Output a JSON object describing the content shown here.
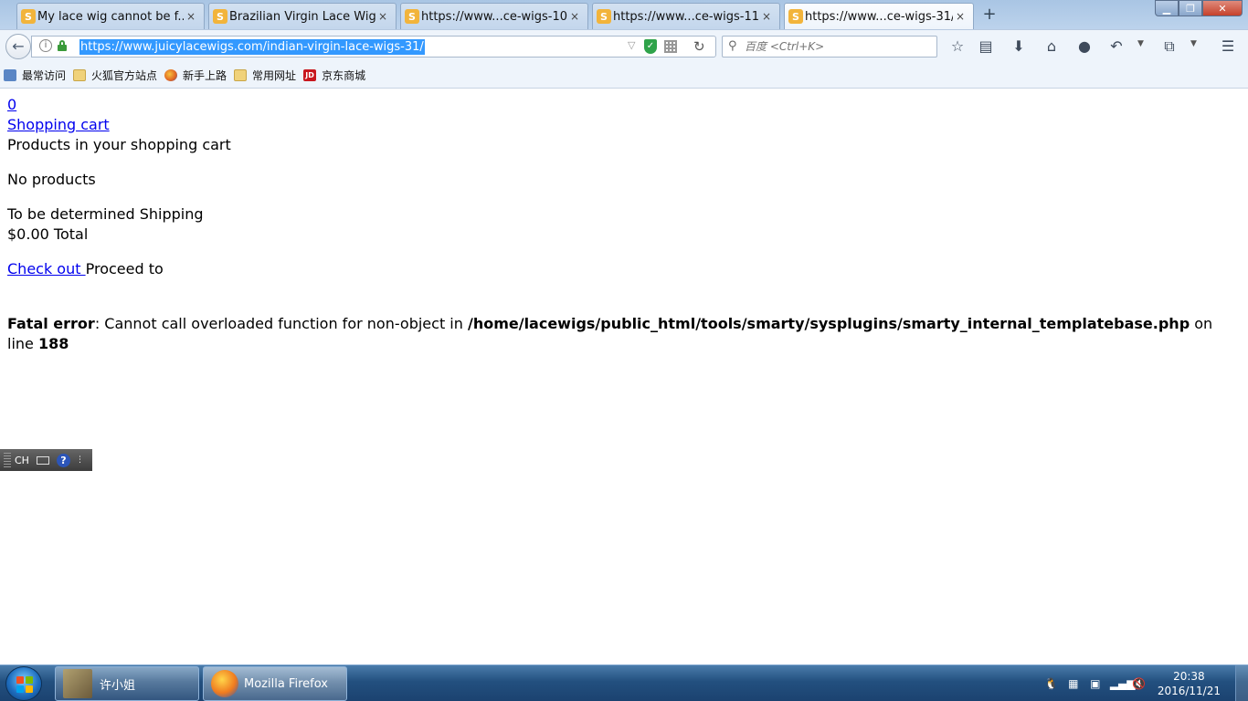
{
  "tabs": [
    {
      "label": "My lace wig cannot be f...",
      "close": "×"
    },
    {
      "label": "Brazilian Virgin Lace Wig...",
      "close": "×"
    },
    {
      "label": "https://www...ce-wigs-10/",
      "close": "×"
    },
    {
      "label": "https://www...ce-wigs-11/",
      "close": "×"
    },
    {
      "label": "https://www...ce-wigs-31/",
      "close": "×"
    }
  ],
  "new_tab_symbol": "+",
  "address_bar": {
    "url": "https://www.juicylacewigs.com/indian-virgin-lace-wigs-31/"
  },
  "search_bar": {
    "placeholder": "百度 <Ctrl+K>"
  },
  "bookmarks": [
    {
      "label": "最常访问",
      "icon": "most-visited-icon"
    },
    {
      "label": "火狐官方站点",
      "icon": "folder-icon"
    },
    {
      "label": "新手上路",
      "icon": "firefox-icon"
    },
    {
      "label": "常用网址",
      "icon": "folder-icon"
    },
    {
      "label": "京东商城",
      "icon": "jd-icon"
    }
  ],
  "page": {
    "cart_count": "0",
    "cart_link": "Shopping cart",
    "cart_heading": "Products in your shopping cart",
    "no_products": "No products",
    "shipping_value": "To be determined",
    "shipping_label": "Shipping",
    "total_value": "$0.00",
    "total_label": "Total",
    "checkout_link": "Check out ",
    "proceed_text": "Proceed to",
    "error": {
      "prefix": "Fatal error",
      "message": ": Cannot call overloaded function for non-object in ",
      "path": "/home/lacewigs/public_html/tools/smarty/sysplugins/smarty_internal_templatebase.php",
      "on_line": " on line ",
      "line": "188"
    }
  },
  "ime": {
    "lang": "CH",
    "help": "?"
  },
  "taskbar": {
    "tasks": [
      {
        "label": "许小姐"
      },
      {
        "label": "Mozilla Firefox"
      }
    ],
    "clock_time": "20:38",
    "clock_date": "2016/11/21"
  }
}
